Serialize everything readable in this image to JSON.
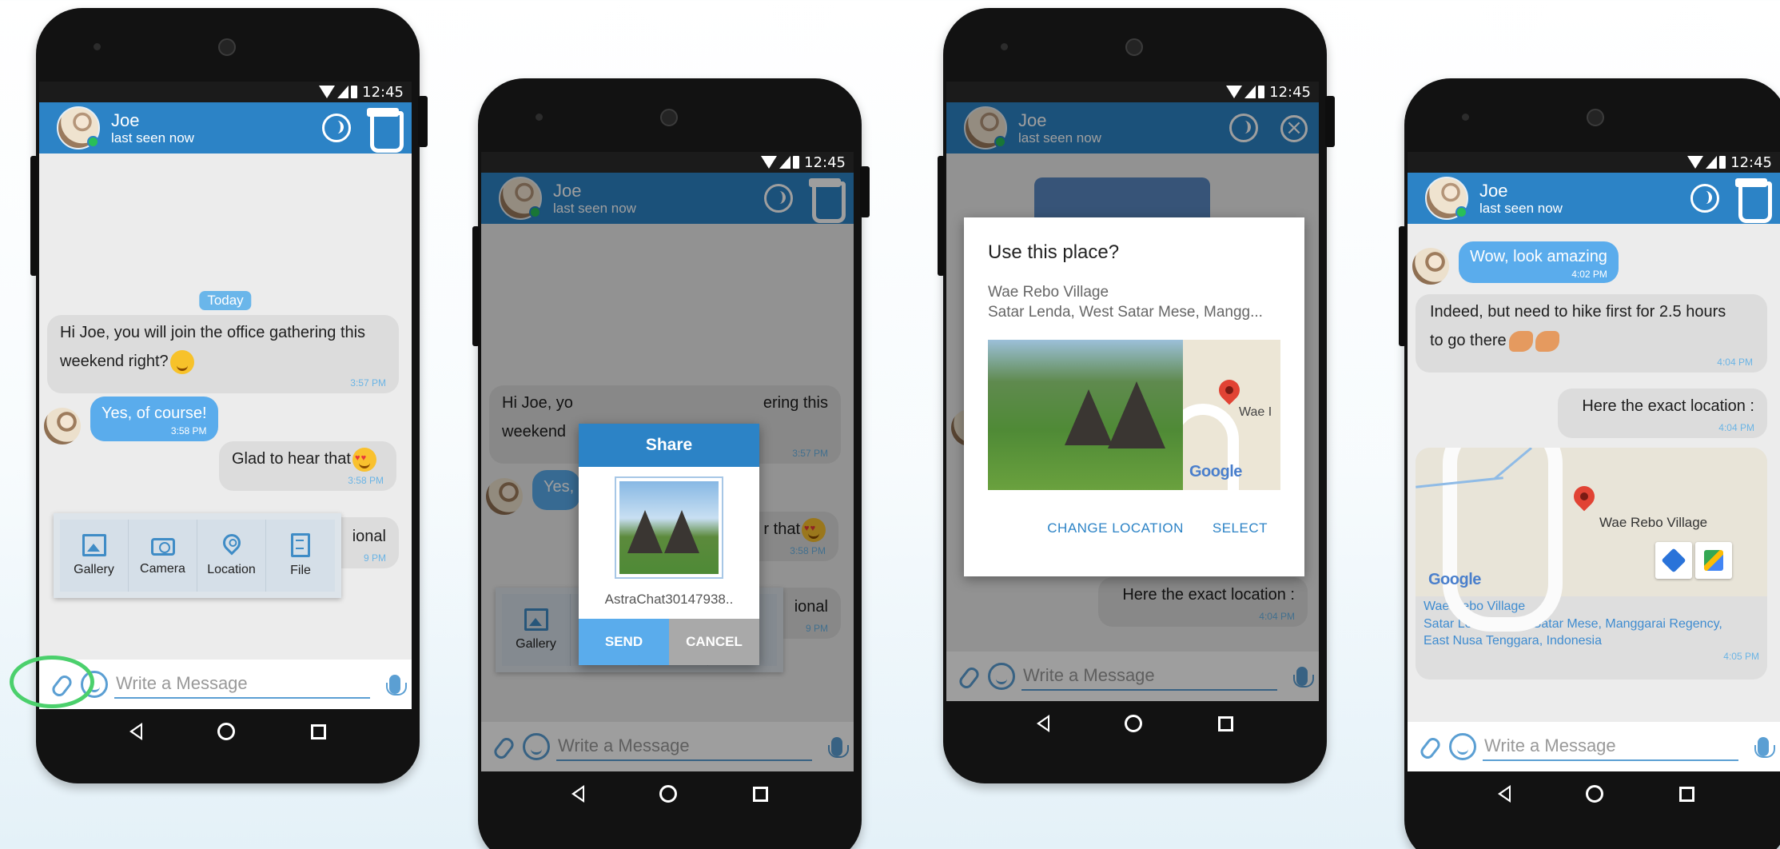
{
  "status_bar": {
    "time": "12:45"
  },
  "contact": {
    "name": "Joe",
    "status": "last seen now"
  },
  "icons": {
    "call": "call-icon",
    "attach_header": "clipboard-icon",
    "close": "close-icon",
    "attach": "paperclip-icon",
    "emoji": "smiley-icon",
    "mic": "microphone-icon",
    "back": "nav-back-icon",
    "home": "nav-home-icon",
    "recents": "nav-recents-icon"
  },
  "colors": {
    "accent": "#2c83c6",
    "outgoing": "#5aacec",
    "incoming": "#dcdcdc",
    "highlight": "#4bd06c"
  },
  "chat": {
    "date_label": "Today",
    "m1": {
      "line1": "Hi Joe, you will join the office gathering this",
      "line2": "weekend right?",
      "time": "3:57 PM"
    },
    "m2": {
      "text": "Yes, of course!",
      "time": "3:58 PM"
    },
    "m3": {
      "text": "Glad to hear that",
      "time": "3:58 PM"
    },
    "m4": {
      "partial": "ional",
      "time": "9 PM"
    }
  },
  "attach_menu": [
    {
      "label": "Gallery",
      "icon": "gallery-icon"
    },
    {
      "label": "Camera",
      "icon": "camera-icon"
    },
    {
      "label": "Location",
      "icon": "location-icon"
    },
    {
      "label": "File",
      "icon": "file-icon"
    }
  ],
  "input": {
    "placeholder": "Write a Message"
  },
  "share_dialog": {
    "title": "Share",
    "filename": "AstraChat30147938..",
    "send": "SEND",
    "cancel": "CANCEL",
    "bg_m1_left1": "Hi Joe, yo",
    "bg_m1_right1": "ering this",
    "bg_m1_left2": "weekend",
    "bg_m1_time": "3:57 PM",
    "bg_m2": "Yes,",
    "bg_m3": "r that",
    "bg_m3_time": "3:58 PM"
  },
  "place_dialog": {
    "question": "Use this place?",
    "place_name": "Wae Rebo Village",
    "address": "Satar Lenda, West Satar Mese, Mangg...",
    "map_label": "Wae I",
    "google": "Google",
    "change": "CHANGE LOCATION",
    "select": "SELECT",
    "bg_msg": "Here the exact location :",
    "bg_time": "4:04 PM"
  },
  "location_chat": {
    "m1": {
      "text": "Wow, look amazing",
      "time": "4:02 PM"
    },
    "m2": {
      "line1": "Indeed, but need to hike first for 2.5 hours",
      "line2": "to go there",
      "time": "4:04 PM"
    },
    "m3": {
      "text": "Here the exact location :",
      "time": "4:04 PM"
    },
    "map": {
      "pin_label": "Wae Rebo Village",
      "google": "Google",
      "name": "Wae Rebo Village",
      "address_line1": "Satar Lenda, West Satar Mese, Manggarai Regency,",
      "address_line2": "East Nusa Tenggara, Indonesia",
      "time": "4:05 PM",
      "directions_icon": "directions-icon",
      "maps_icon": "google-maps-icon"
    }
  }
}
